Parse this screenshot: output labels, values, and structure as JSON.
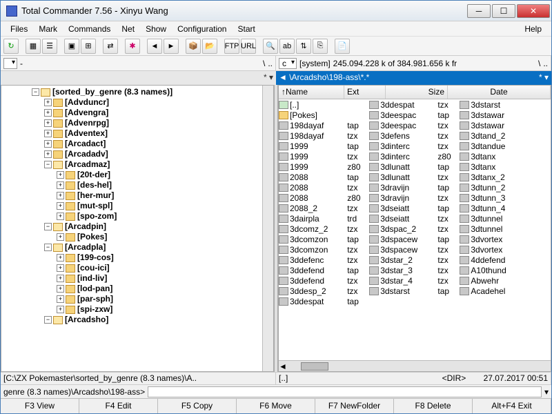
{
  "window": {
    "title": "Total Commander 7.56 - Xinyu Wang"
  },
  "menu": {
    "files": "Files",
    "mark": "Mark",
    "commands": "Commands",
    "net": "Net",
    "show": "Show",
    "config": "Configuration",
    "start": "Start",
    "help": "Help"
  },
  "driveRight": {
    "letter": "c",
    "label": "[system]",
    "space": "245.094.228 k of 384.981.656 k fr"
  },
  "driveLeft": {
    "letter": "-"
  },
  "pathLeft": "",
  "pathRight": "\\Arcadsho\\198-ass\\*.*",
  "columns": {
    "name": "Name",
    "ext": "Ext",
    "size": "Size",
    "date": "Date"
  },
  "tree": {
    "root": "[sorted_by_genre (8.3 names)]",
    "items": [
      {
        "t": "[Advduncr]",
        "d": 1
      },
      {
        "t": "[Advengra]",
        "d": 1
      },
      {
        "t": "[Advenrpg]",
        "d": 1
      },
      {
        "t": "[Adventex]",
        "d": 1
      },
      {
        "t": "[Arcadact]",
        "d": 1
      },
      {
        "t": "[Arcadadv]",
        "d": 1
      },
      {
        "t": "[Arcadmaz]",
        "d": 1,
        "open": true
      },
      {
        "t": "[20t-der]",
        "d": 2
      },
      {
        "t": "[des-hel]",
        "d": 2
      },
      {
        "t": "[her-mur]",
        "d": 2
      },
      {
        "t": "[mut-spl]",
        "d": 2
      },
      {
        "t": "[spo-zom]",
        "d": 2
      },
      {
        "t": "[Arcadpin]",
        "d": 1,
        "open": true
      },
      {
        "t": "[Pokes]",
        "d": 2
      },
      {
        "t": "[Arcadpla]",
        "d": 1,
        "open": true
      },
      {
        "t": "[199-cos]",
        "d": 2
      },
      {
        "t": "[cou-ici]",
        "d": 2
      },
      {
        "t": "[ind-liv]",
        "d": 2
      },
      {
        "t": "[lod-pan]",
        "d": 2
      },
      {
        "t": "[par-sph]",
        "d": 2
      },
      {
        "t": "[spi-zxw]",
        "d": 2
      },
      {
        "t": "[Arcadsho]",
        "d": 1,
        "open": true
      }
    ]
  },
  "files": {
    "col1": [
      {
        "n": "[..]",
        "e": "",
        "up": true
      },
      {
        "n": "[Pokes]",
        "e": "",
        "fold": true
      },
      {
        "n": "198dayaf",
        "e": "tap"
      },
      {
        "n": "198dayaf",
        "e": "tzx"
      },
      {
        "n": "1999",
        "e": "tap"
      },
      {
        "n": "1999",
        "e": "tzx"
      },
      {
        "n": "1999",
        "e": "z80"
      },
      {
        "n": "2088",
        "e": "tap"
      },
      {
        "n": "2088",
        "e": "tzx"
      },
      {
        "n": "2088",
        "e": "z80"
      },
      {
        "n": "2088_2",
        "e": "tzx"
      },
      {
        "n": "3dairpla",
        "e": "trd"
      },
      {
        "n": "3dcomz_2",
        "e": "tzx"
      },
      {
        "n": "3dcomzon",
        "e": "tap"
      },
      {
        "n": "3dcomzon",
        "e": "tzx"
      },
      {
        "n": "3ddefenc",
        "e": "tzx"
      },
      {
        "n": "3ddefend",
        "e": "tap"
      },
      {
        "n": "3ddefend",
        "e": "tzx"
      },
      {
        "n": "3ddesp_2",
        "e": "tzx"
      },
      {
        "n": "3ddespat",
        "e": "tap"
      }
    ],
    "col2": [
      {
        "n": "3ddespat",
        "e": "tzx"
      },
      {
        "n": "3deespac",
        "e": "tap"
      },
      {
        "n": "3deespac",
        "e": "tzx"
      },
      {
        "n": "3defens",
        "e": "tzx"
      },
      {
        "n": "3dinterc",
        "e": "tzx"
      },
      {
        "n": "3dinterc",
        "e": "z80"
      },
      {
        "n": "3dlunatt",
        "e": "tap"
      },
      {
        "n": "3dlunatt",
        "e": "tzx"
      },
      {
        "n": "3dravijn",
        "e": "tap"
      },
      {
        "n": "3dravijn",
        "e": "tzx"
      },
      {
        "n": "3dseiatt",
        "e": "tap"
      },
      {
        "n": "3dseiatt",
        "e": "tzx"
      },
      {
        "n": "3dspac_2",
        "e": "tzx"
      },
      {
        "n": "3dspacew",
        "e": "tap"
      },
      {
        "n": "3dspacew",
        "e": "tzx"
      },
      {
        "n": "3dstar_2",
        "e": "tzx"
      },
      {
        "n": "3dstar_3",
        "e": "tzx"
      },
      {
        "n": "3dstar_4",
        "e": "tzx"
      },
      {
        "n": "3dstarst",
        "e": "tap"
      }
    ],
    "col3": [
      {
        "n": "3dstarst",
        "e": ""
      },
      {
        "n": "3dstawar",
        "e": ""
      },
      {
        "n": "3dstawar",
        "e": ""
      },
      {
        "n": "3dtand_2",
        "e": ""
      },
      {
        "n": "3dtandue",
        "e": ""
      },
      {
        "n": "3dtanx",
        "e": ""
      },
      {
        "n": "3dtanx",
        "e": ""
      },
      {
        "n": "3dtanx_2",
        "e": ""
      },
      {
        "n": "3dtunn_2",
        "e": ""
      },
      {
        "n": "3dtunn_3",
        "e": ""
      },
      {
        "n": "3dtunn_4",
        "e": ""
      },
      {
        "n": "3dtunnel",
        "e": ""
      },
      {
        "n": "3dtunnel",
        "e": ""
      },
      {
        "n": "3dvortex",
        "e": ""
      },
      {
        "n": "3dvortex",
        "e": ""
      },
      {
        "n": "4ddefend",
        "e": ""
      },
      {
        "n": "A10thund",
        "e": ""
      },
      {
        "n": "Abwehr",
        "e": ""
      },
      {
        "n": "Acadehel",
        "e": ""
      }
    ]
  },
  "statusLeft": "[C:\\ZX Pokemaster\\sorted_by_genre (8.3 names)\\A..",
  "statusRight_name": "[..]",
  "statusRight_dir": "<DIR>",
  "statusRight_date": "27.07.2017 00:51",
  "cmdPrompt": "genre (8.3 names)\\Arcadsho\\198-ass>",
  "fkeys": {
    "f3": "F3 View",
    "f4": "F4 Edit",
    "f5": "F5 Copy",
    "f6": "F6 Move",
    "f7": "F7 NewFolder",
    "f8": "F8 Delete",
    "af4": "Alt+F4 Exit"
  }
}
